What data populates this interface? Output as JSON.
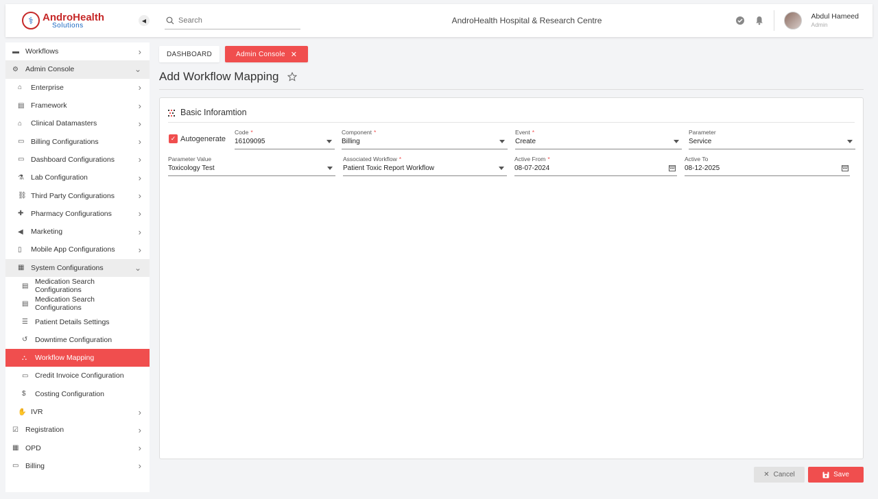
{
  "header": {
    "brand_name": "AndroHealth",
    "brand_sub": "Solutions",
    "search_placeholder": "Search",
    "hospital_title": "AndroHealth Hospital & Research Centre",
    "user_name": "Abdul Hameed",
    "user_role": "Admin"
  },
  "sidebar": {
    "items": [
      {
        "label": "Workflows",
        "icon": "monitor-icon",
        "level": 0,
        "state": "collapsed"
      },
      {
        "label": "Admin Console",
        "icon": "gear-icon",
        "level": 0,
        "state": "open"
      },
      {
        "label": "Enterprise",
        "icon": "bank-icon",
        "level": 1,
        "state": "collapsed"
      },
      {
        "label": "Framework",
        "icon": "layers-icon",
        "level": 1,
        "state": "collapsed"
      },
      {
        "label": "Clinical Datamasters",
        "icon": "home-icon",
        "level": 1,
        "state": "collapsed"
      },
      {
        "label": "Billing Configurations",
        "icon": "card-icon",
        "level": 1,
        "state": "collapsed"
      },
      {
        "label": "Dashboard Configurations",
        "icon": "card-icon",
        "level": 1,
        "state": "collapsed"
      },
      {
        "label": "Lab Configuration",
        "icon": "flask-icon",
        "level": 1,
        "state": "collapsed"
      },
      {
        "label": "Third Party Configurations",
        "icon": "link-icon",
        "level": 1,
        "state": "collapsed"
      },
      {
        "label": "Pharmacy Configurations",
        "icon": "medkit-icon",
        "level": 1,
        "state": "collapsed"
      },
      {
        "label": "Marketing",
        "icon": "megaphone-icon",
        "level": 1,
        "state": "collapsed"
      },
      {
        "label": "Mobile App Configurations",
        "icon": "mobile-icon",
        "level": 1,
        "state": "collapsed"
      },
      {
        "label": "System Configurations",
        "icon": "building-icon",
        "level": 1,
        "state": "open"
      },
      {
        "label": "Medication Search Configurations",
        "icon": "document-icon",
        "level": 2,
        "state": "leaf"
      },
      {
        "label": "Medication Search Configurations",
        "icon": "document-icon",
        "level": 2,
        "state": "leaf"
      },
      {
        "label": "Patient Details Settings",
        "icon": "user-list-icon",
        "level": 2,
        "state": "leaf"
      },
      {
        "label": "Downtime Configuration",
        "icon": "history-icon",
        "level": 2,
        "state": "leaf"
      },
      {
        "label": "Workflow Mapping",
        "icon": "sitemap-icon",
        "level": 2,
        "state": "active"
      },
      {
        "label": "Credit Invoice Configuration",
        "icon": "invoice-icon",
        "level": 2,
        "state": "leaf"
      },
      {
        "label": "Costing Configuration",
        "icon": "dollar-icon",
        "level": 2,
        "state": "leaf"
      },
      {
        "label": "IVR",
        "icon": "hand-icon",
        "level": 1,
        "state": "collapsed"
      },
      {
        "label": "Registration",
        "icon": "checkbox-icon",
        "level": 0,
        "state": "collapsed"
      },
      {
        "label": "OPD",
        "icon": "hospital-icon",
        "level": 0,
        "state": "collapsed"
      },
      {
        "label": "Billing",
        "icon": "card-icon",
        "level": 0,
        "state": "collapsed"
      }
    ]
  },
  "breadcrumbs": {
    "dashboard": "DASHBOARD",
    "admin_console": "Admin Console"
  },
  "page": {
    "title": "Add Workflow Mapping"
  },
  "form": {
    "section_title": "Basic Inforamtion",
    "autogenerate_label": "Autogenerate",
    "autogenerate_checked": true,
    "code": {
      "label": "Code",
      "value": "16109095",
      "required": true
    },
    "component": {
      "label": "Component",
      "value": "Billing",
      "required": true
    },
    "event": {
      "label": "Event",
      "value": "Create",
      "required": true
    },
    "parameter": {
      "label": "Parameter",
      "value": "Service",
      "required": false
    },
    "parameter_value": {
      "label": "Parameter Value",
      "value": "Toxicology Test",
      "required": false
    },
    "associated_workflow": {
      "label": "Associated Workflow",
      "value": "Patient Toxic Report Workflow",
      "required": true
    },
    "active_from": {
      "label": "Active From",
      "value": "08-07-2024",
      "required": true
    },
    "active_to": {
      "label": "Active To",
      "value": "08-12-2025",
      "required": false
    },
    "required_mark": "*"
  },
  "actions": {
    "cancel_label": "Cancel",
    "save_label": "Save"
  },
  "colors": {
    "accent": "#f04e4e",
    "brand_red": "#c62828",
    "brand_blue": "#1565c0"
  }
}
